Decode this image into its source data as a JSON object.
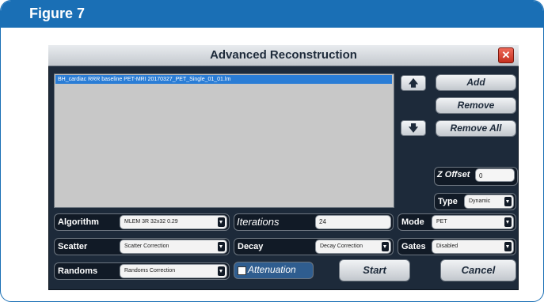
{
  "figure": {
    "title": "Figure 7"
  },
  "dialog": {
    "title": "Advanced Reconstruction",
    "close_glyph": "✕",
    "file_list": [
      "BH_cardiac RRR baseline PET-MRI 20170327_PET_Single_01_01.lm"
    ],
    "buttons": {
      "up_glyph": "🡅",
      "down_glyph": "🡇",
      "add": "Add",
      "remove": "Remove",
      "remove_all": "Remove All",
      "start": "Start",
      "cancel": "Cancel"
    },
    "z_offset": {
      "label": "Z Offset",
      "value": "0"
    },
    "type": {
      "label": "Type",
      "value": "Dynamic"
    },
    "algorithm": {
      "label": "Algorithm",
      "value": "MLEM 3R 32x32 0.29"
    },
    "iterations": {
      "label": "Iterations",
      "value": "24"
    },
    "mode": {
      "label": "Mode",
      "value": "PET"
    },
    "scatter": {
      "label": "Scatter",
      "value": "Scatter Correction"
    },
    "decay": {
      "label": "Decay",
      "value": "Decay Correction"
    },
    "gates": {
      "label": "Gates",
      "value": "Disabled"
    },
    "randoms": {
      "label": "Randoms",
      "value": "Randoms Correction"
    },
    "attenuation": {
      "label": "Attenuation",
      "checked": false
    }
  },
  "colors": {
    "header_blue": "#1a6fb5",
    "dialog_bg": "#1d2a3a",
    "selection": "#2a7dd6"
  }
}
